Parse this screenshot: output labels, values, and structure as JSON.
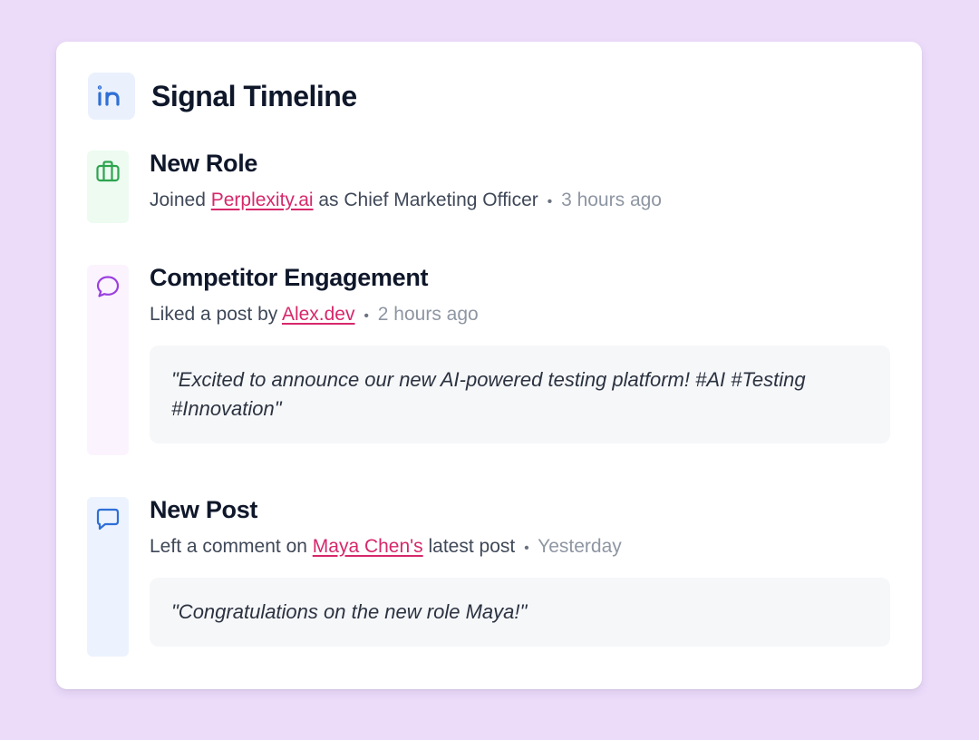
{
  "header": {
    "title": "Signal Timeline",
    "icon": "linkedin-icon",
    "icon_color": "#2f6fd6"
  },
  "items": [
    {
      "title": "New Role",
      "icon": "briefcase-icon",
      "icon_color": "#2ea44f",
      "rail_color": "#edfbf1",
      "desc_before": "Joined ",
      "link": "Perplexity.ai",
      "desc_after": " as Chief Marketing Officer",
      "separator": "•",
      "time": "3 hours ago"
    },
    {
      "title": "Competitor Engagement",
      "icon": "chat-bubble-round-icon",
      "icon_color": "#9b3fe0",
      "rail_color": "#fbf3fe",
      "desc_before": "Liked a post by ",
      "link": "Alex.dev",
      "desc_after": "",
      "separator": "•",
      "time": "2 hours ago",
      "quote": "\"Excited to announce our new AI-powered testing platform! #AI #Testing #Innovation\""
    },
    {
      "title": "New Post",
      "icon": "chat-bubble-square-icon",
      "icon_color": "#2f6fd6",
      "rail_color": "#ecf3fe",
      "desc_before": "Left a comment on ",
      "link": "Maya Chen's",
      "desc_after": " latest post",
      "separator": "•",
      "time": "Yesterday",
      "quote": "\"Congratulations on the new role Maya!\""
    }
  ],
  "colors": {
    "page_background": "#ecdcfa",
    "card_background": "#ffffff",
    "link": "#d6286b",
    "title_text": "#0f172a"
  }
}
